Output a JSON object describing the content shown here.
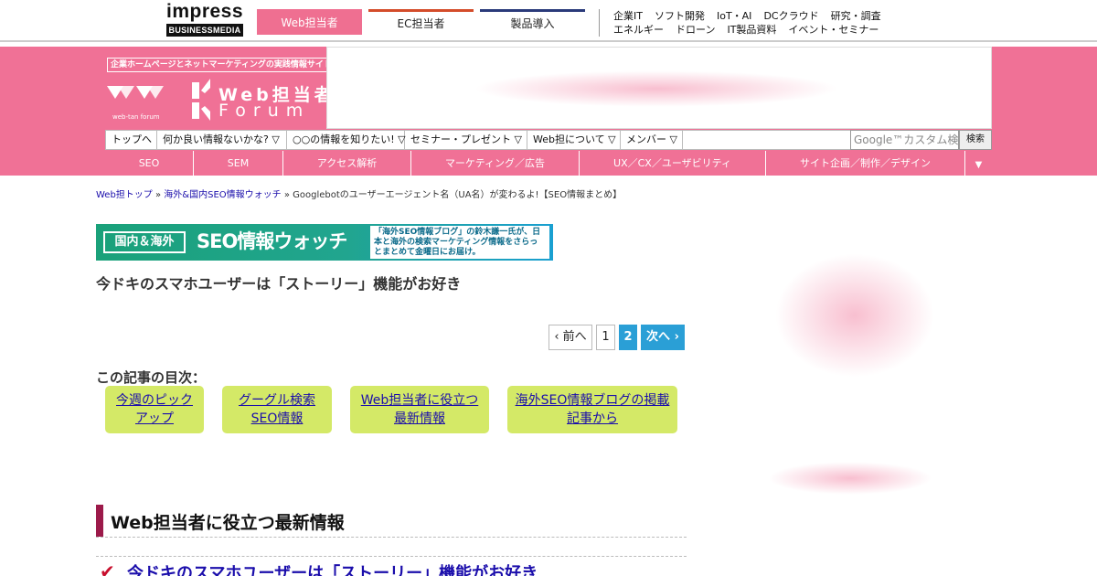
{
  "impress": {
    "line1": "impress",
    "line2": "BUSINESSMEDIA"
  },
  "site_tabs": {
    "web": "Web担当者",
    "ec": "EC担当者",
    "products": "製品導入"
  },
  "top_links": [
    [
      "企業IT",
      "ソフト開発",
      "IoT・AI",
      "DCクラウド",
      "研究・調査"
    ],
    [
      "エネルギー",
      "ドローン",
      "IT製品資料",
      "イベント・セミナー"
    ]
  ],
  "header": {
    "tagline": "企業ホームページとネットマーケティングの実践情報サイト",
    "logo_web": "Web担当者",
    "logo_forum": "Forum",
    "logo_sub": "web-tan forum"
  },
  "nav1": [
    "トップへ",
    "何か良い情報ないかな? ▽",
    "○○の情報を知りたい! ▽",
    "セミナー・プレゼント ▽",
    "Web担について ▽",
    "メンバー ▽"
  ],
  "search": {
    "placeholder": "Google™カスタム検索",
    "button": "検索"
  },
  "nav2": [
    "SEO",
    "SEM",
    "アクセス解析",
    "マーケティング／広告",
    "UX／CX／ユーザビリティ",
    "サイト企画／制作／デザイン"
  ],
  "nav2_more": "▼",
  "breadcrumb": {
    "home": "Web担トップ",
    "sep": " » ",
    "category": "海外&国内SEO情報ウォッチ",
    "current": "Googlebotのユーザーエージェント名（UA名）が変わるよ!【SEO情報まとめ】"
  },
  "seo_banner": {
    "badge": "国内＆海外",
    "title": "SEO情報ウォッチ",
    "desc": "「海外SEO情報ブログ」の鈴木謙一氏が、日本と海外の検索マーケティング情報をさらっとまとめて金曜日にお届け。"
  },
  "article_title": "今ドキのスマホユーザーは「ストーリー」機能がお好き",
  "pager": {
    "prev": "‹ 前へ",
    "p1": "1",
    "p2": "2",
    "next": "次へ ›"
  },
  "toc": {
    "heading": "この記事の目次：",
    "items": [
      [
        "今週のピック",
        "アップ"
      ],
      [
        "グーグル検索",
        "SEO情報"
      ],
      [
        "Web担当者に役立つ",
        "最新情報"
      ],
      [
        "海外SEO情報ブログの掲載",
        "記事から"
      ]
    ]
  },
  "section": {
    "heading": "Web担当者に役立つ最新情報",
    "article_link": "今ドキのスマホユーザーは「ストーリー」機能がお好き"
  },
  "colors": {
    "brand_pink": "#f07196",
    "toc_green": "#d4e967",
    "pager_blue": "#2a9fd6",
    "section_bar": "#9c1a4a"
  }
}
